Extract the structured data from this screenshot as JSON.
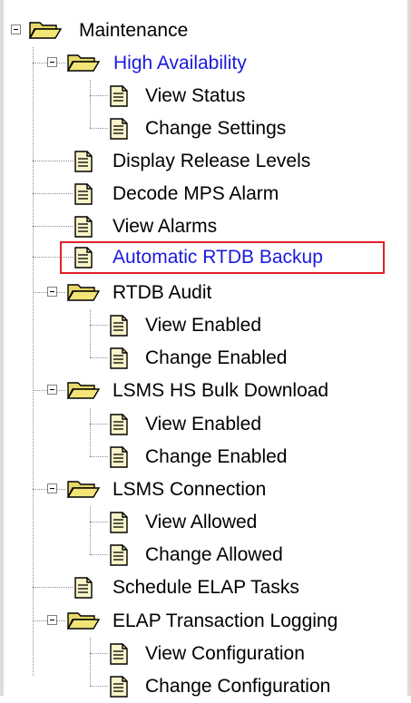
{
  "tree": {
    "root": {
      "label": "Maintenance",
      "children": [
        {
          "label": "High Availability",
          "children": [
            {
              "label": "View Status"
            },
            {
              "label": "Change Settings"
            }
          ]
        },
        {
          "label": "Display Release Levels"
        },
        {
          "label": "Decode MPS Alarm"
        },
        {
          "label": "View Alarms"
        },
        {
          "label": "Automatic RTDB Backup"
        },
        {
          "label": "RTDB Audit",
          "children": [
            {
              "label": "View Enabled"
            },
            {
              "label": "Change Enabled"
            }
          ]
        },
        {
          "label": "LSMS HS Bulk Download",
          "children": [
            {
              "label": "View Enabled"
            },
            {
              "label": "Change Enabled"
            }
          ]
        },
        {
          "label": "LSMS Connection",
          "children": [
            {
              "label": "View Allowed"
            },
            {
              "label": "Change Allowed"
            }
          ]
        },
        {
          "label": "Schedule ELAP Tasks"
        },
        {
          "label": "ELAP Transaction Logging",
          "children": [
            {
              "label": "View Configuration"
            },
            {
              "label": "Change Configuration"
            }
          ]
        }
      ]
    },
    "link_color": "#1a1adc",
    "highlight_color": "#e0202a",
    "folder_color": "#e8d86a",
    "document_color": "#f8f4c8"
  }
}
